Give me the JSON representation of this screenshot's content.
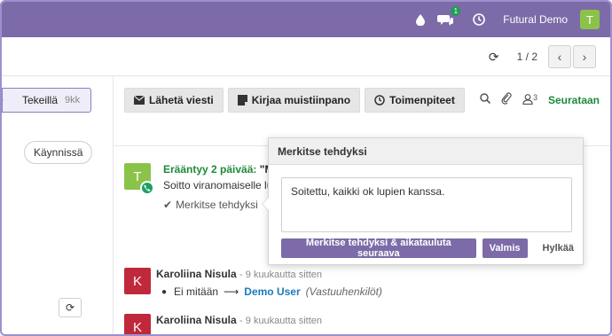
{
  "navbar": {
    "chat_badge": "1",
    "company": "Futural Demo",
    "user_initial": "T",
    "colors": {
      "brand": "#7c6ba8",
      "avatar": "#8bc34a"
    }
  },
  "pager": {
    "value": "1 / 2"
  },
  "status": {
    "stage_label": "Tekeillä",
    "stage_count": "9kk",
    "chip_label": "Käynnissä"
  },
  "chatter": {
    "send_message": "Lähetä viesti",
    "log_note": "Kirjaa muistiinpano",
    "schedule_activity": "Toimenpiteet",
    "followers_count": "3",
    "follow_label": "Seurataan"
  },
  "activity": {
    "avatar_initial": "T",
    "due": "Erääntyy 2 päivää:",
    "summary": "\"M",
    "note": "Soitto viranomaiselle lu",
    "mark_done": "Merkitse tehdyksi"
  },
  "popover": {
    "title": "Merkitse tehdyksi",
    "feedback": "Soitettu, kaikki ok lupien kanssa.",
    "done_schedule_next": "Merkitse tehdyksi & aikatauluta seuraava",
    "done": "Valmis",
    "discard": "Hylkää"
  },
  "messages": [
    {
      "avatar_initial": "K",
      "author": "Karoliina Nisula",
      "date": "- 9 kuukautta sitten",
      "old_value": "Ei mitään",
      "new_value": "Demo User",
      "field": "(Vastuuhenkilöt)"
    },
    {
      "avatar_initial": "K",
      "author": "Karoliina Nisula",
      "date": "- 9 kuukautta sitten"
    }
  ]
}
